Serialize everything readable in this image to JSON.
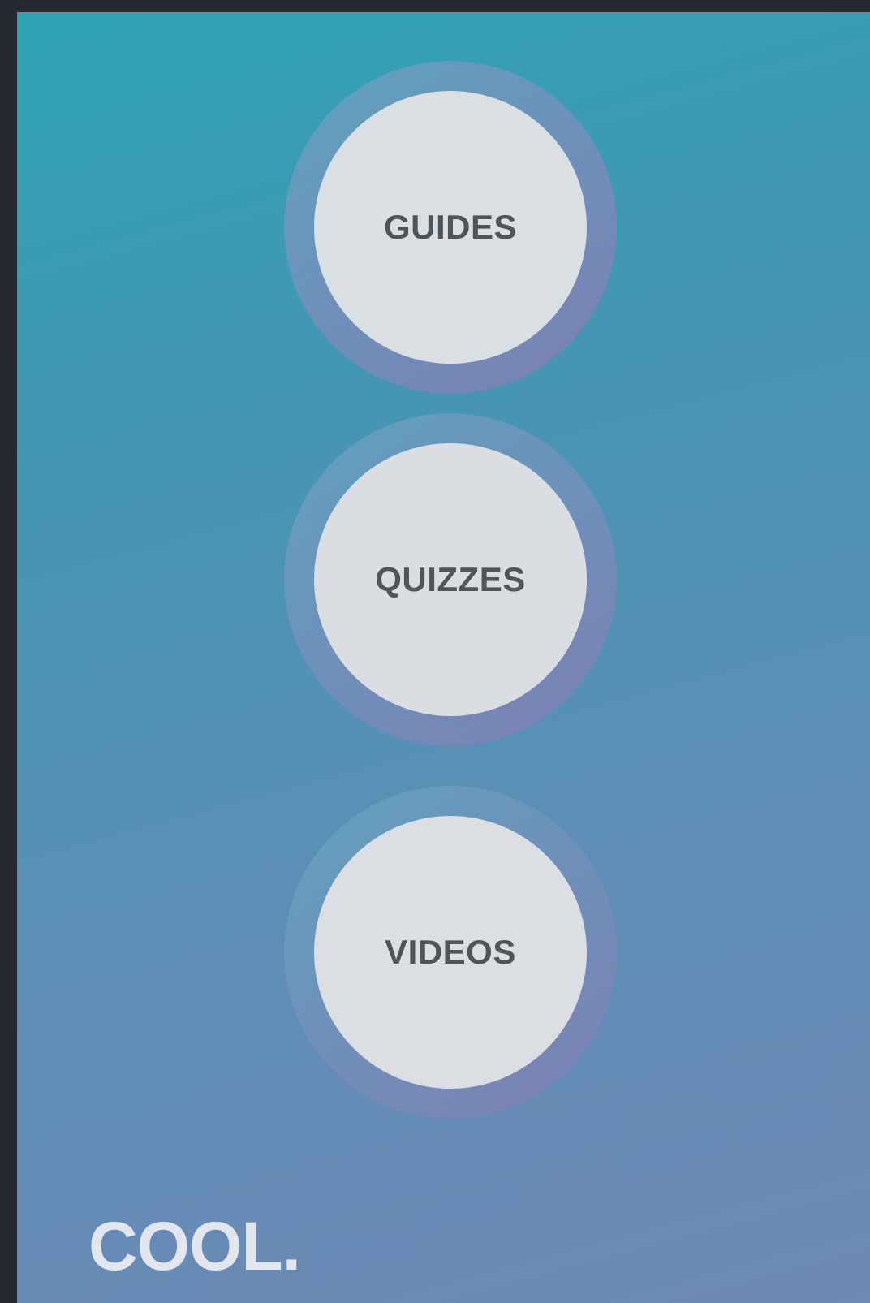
{
  "menu": {
    "items": [
      {
        "label": "GUIDES"
      },
      {
        "label": "QUIZZES"
      },
      {
        "label": "VIDEOS"
      }
    ]
  },
  "brand": {
    "text": "COOL."
  },
  "colors": {
    "background_dark": "#262830",
    "gradient_top": "#2fa3b6",
    "gradient_bottom": "#6f88b5",
    "ring": "#7f7fb3",
    "circle": "#e2e3e5",
    "label": "#4f5256",
    "brand": "#e3e6ee"
  }
}
